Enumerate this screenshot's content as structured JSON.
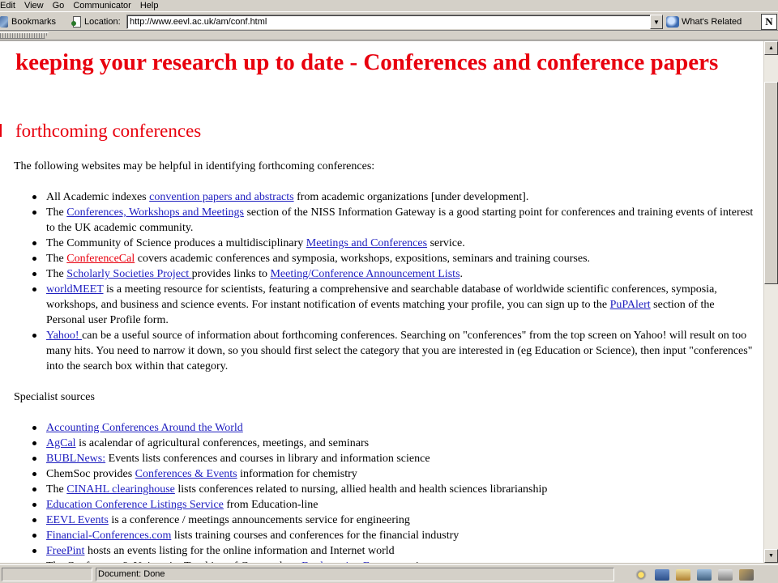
{
  "menu": [
    "Edit",
    "View",
    "Go",
    "Communicator",
    "Help"
  ],
  "toolbar": {
    "bookmarks_label": "Bookmarks",
    "location_label": "Location:",
    "url": "http://www.eevl.ac.uk/am/conf.html",
    "related_label": "What's Related",
    "logo_letter": "N"
  },
  "page": {
    "title": "keeping your research up to date - Conferences and conference papers",
    "section_heading": "forthcoming conferences",
    "intro": "The following websites may be helpful in identifying forthcoming conferences:",
    "list1": [
      [
        {
          "t": "All Academic indexes "
        },
        {
          "t": "convention papers and abstracts",
          "link": true
        },
        {
          "t": " from academic organizations [under development]."
        }
      ],
      [
        {
          "t": "The "
        },
        {
          "t": "Conferences, Workshops and Meetings",
          "link": true
        },
        {
          "t": " section of the NISS Information Gateway is a good starting point for conferences and training events of interest to the UK academic community."
        }
      ],
      [
        {
          "t": "The Community of Science produces a multidisciplinary "
        },
        {
          "t": "Meetings and Conferences",
          "link": true
        },
        {
          "t": " service."
        }
      ],
      [
        {
          "t": "The "
        },
        {
          "t": "ConferenceCal",
          "link": "red"
        },
        {
          "t": " covers academic conferences and symposia, workshops, expositions, seminars and training courses."
        }
      ],
      [
        {
          "t": "The "
        },
        {
          "t": "Scholarly Societies Project ",
          "link": true
        },
        {
          "t": "provides links to "
        },
        {
          "t": "Meeting/Conference Announcement Lists",
          "link": true
        },
        {
          "t": "."
        }
      ],
      [
        {
          "t": "worldMEET",
          "link": true
        },
        {
          "t": " is a meeting resource for scientists, featuring a comprehensive and searchable database of worldwide scientific conferences, symposia, workshops, and business and science events. For instant notification of events matching your profile, you can sign up to the "
        },
        {
          "t": "PuPAlert",
          "link": true
        },
        {
          "t": " section of the Personal user Profile form."
        }
      ],
      [
        {
          "t": "Yahoo! ",
          "link": true
        },
        {
          "t": "can be a useful source of information about forthcoming conferences. Searching on \"conferences\" from the top screen on Yahoo! will result on too many hits.  You need to narrow it down, so you should first select the category that you are interested in (eg Education or Science), then input \"conferences\" into the search box within that category."
        }
      ]
    ],
    "specialist_heading": "Specialist sources",
    "list2": [
      [
        {
          "t": "Accounting Conferences Around the World",
          "link": true
        }
      ],
      [
        {
          "t": "AgCal",
          "link": true
        },
        {
          "t": " is acalendar of agricultural conferences, meetings, and seminars"
        }
      ],
      [
        {
          "t": "BUBLNews:",
          "link": true
        },
        {
          "t": " Events lists conferences and courses in library and information science"
        }
      ],
      [
        {
          "t": "ChemSoc provides "
        },
        {
          "t": "Conferences & Events",
          "link": true
        },
        {
          "t": " information for chemistry"
        }
      ],
      [
        {
          "t": "The "
        },
        {
          "t": "CINAHL clearinghouse",
          "link": true
        },
        {
          "t": " lists conferences related to nursing, allied health and health sciences librarianship"
        }
      ],
      [
        {
          "t": "Education Conference Listings Service",
          "link": true
        },
        {
          "t": " from Education-line"
        }
      ],
      [
        {
          "t": "EEVL Events",
          "link": true
        },
        {
          "t": " is a conference / meetings announcements service for engineering"
        }
      ],
      [
        {
          "t": "Financial-Conferences.com",
          "link": true
        },
        {
          "t": " lists training courses and conferences for the financial industry"
        }
      ],
      [
        {
          "t": "FreePint",
          "link": true
        },
        {
          "t": " hosts an events listing for the online information and Internet world"
        }
      ],
      [
        {
          "t": "The Conference & University Teaching of Geography... ",
          "link": false
        },
        {
          "t": "Forthcoming Events",
          "link": true
        },
        {
          "t": " service"
        }
      ]
    ]
  },
  "status": {
    "text": "Document: Done"
  },
  "icons": [
    "bookmarks-icon",
    "location-icon",
    "whats-related-icon",
    "netscape-logo",
    "security-icon",
    "mail-icon",
    "network-icon",
    "composer-icon",
    "print-icon"
  ]
}
